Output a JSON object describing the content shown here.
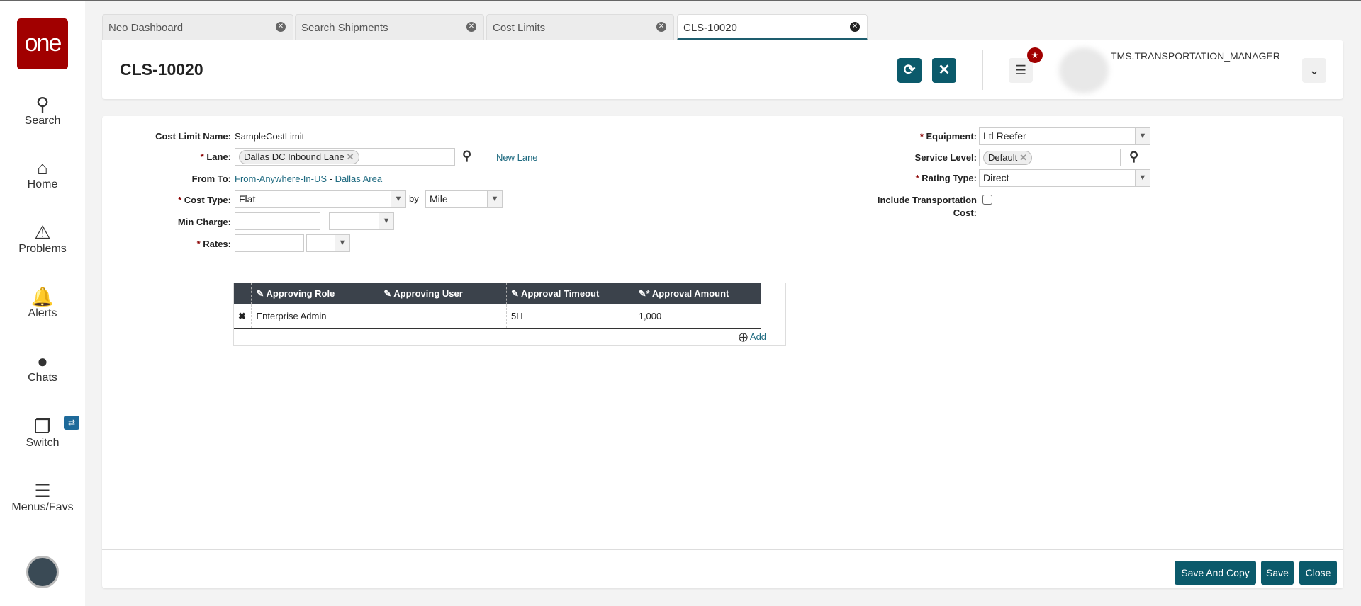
{
  "sidebar": {
    "logo": "one",
    "items": [
      {
        "label": "Search",
        "icon": "search-icon"
      },
      {
        "label": "Home",
        "icon": "home-icon"
      },
      {
        "label": "Problems",
        "icon": "warning-icon"
      },
      {
        "label": "Alerts",
        "icon": "bell-icon"
      },
      {
        "label": "Chats",
        "icon": "chat-icon"
      },
      {
        "label": "Switch",
        "icon": "switch-icon"
      },
      {
        "label": "Menus/Favs",
        "icon": "menu-icon"
      }
    ]
  },
  "tabs": [
    {
      "label": "Neo Dashboard"
    },
    {
      "label": "Search Shipments"
    },
    {
      "label": "Cost Limits"
    },
    {
      "label": "CLS-10020",
      "active": true
    }
  ],
  "header": {
    "title": "CLS-10020",
    "user_role": "TMS.TRANSPORTATION_MANAGER"
  },
  "form": {
    "cost_limit_name": {
      "label": "Cost Limit Name:",
      "value": "SampleCostLimit"
    },
    "lane": {
      "label": "Lane:",
      "value": "Dallas DC Inbound Lane",
      "new_lane": "New Lane"
    },
    "from_to": {
      "label": "From To:",
      "from": "From-Anywhere-In-US",
      "sep": " - ",
      "to": "Dallas Area"
    },
    "cost_type": {
      "label": "Cost Type:",
      "value": "Flat",
      "by": "by",
      "unit": "Mile"
    },
    "min_charge": {
      "label": "Min Charge:",
      "value": "",
      "unit": ""
    },
    "rates": {
      "label": "Rates:",
      "value": "",
      "unit": ""
    },
    "equipment": {
      "label": "Equipment:",
      "value": "Ltl Reefer"
    },
    "service_level": {
      "label": "Service Level:",
      "value": "Default"
    },
    "rating_type": {
      "label": "Rating Type:",
      "value": "Direct"
    },
    "include_transport": {
      "label_line1": "Include Transportation",
      "label_line2": "Cost:",
      "checked": false
    }
  },
  "table": {
    "columns": [
      "Approving Role",
      "Approving User",
      "Approval Timeout",
      "Approval Amount"
    ],
    "rows": [
      {
        "role": "Enterprise Admin",
        "user": "",
        "timeout": "5H",
        "amount": "1,000"
      }
    ],
    "add_label": "Add"
  },
  "footer": {
    "save_and_copy": "Save And Copy",
    "save": "Save",
    "close": "Close"
  },
  "colors": {
    "brand": "#a10000",
    "primary": "#0b5a6b"
  }
}
